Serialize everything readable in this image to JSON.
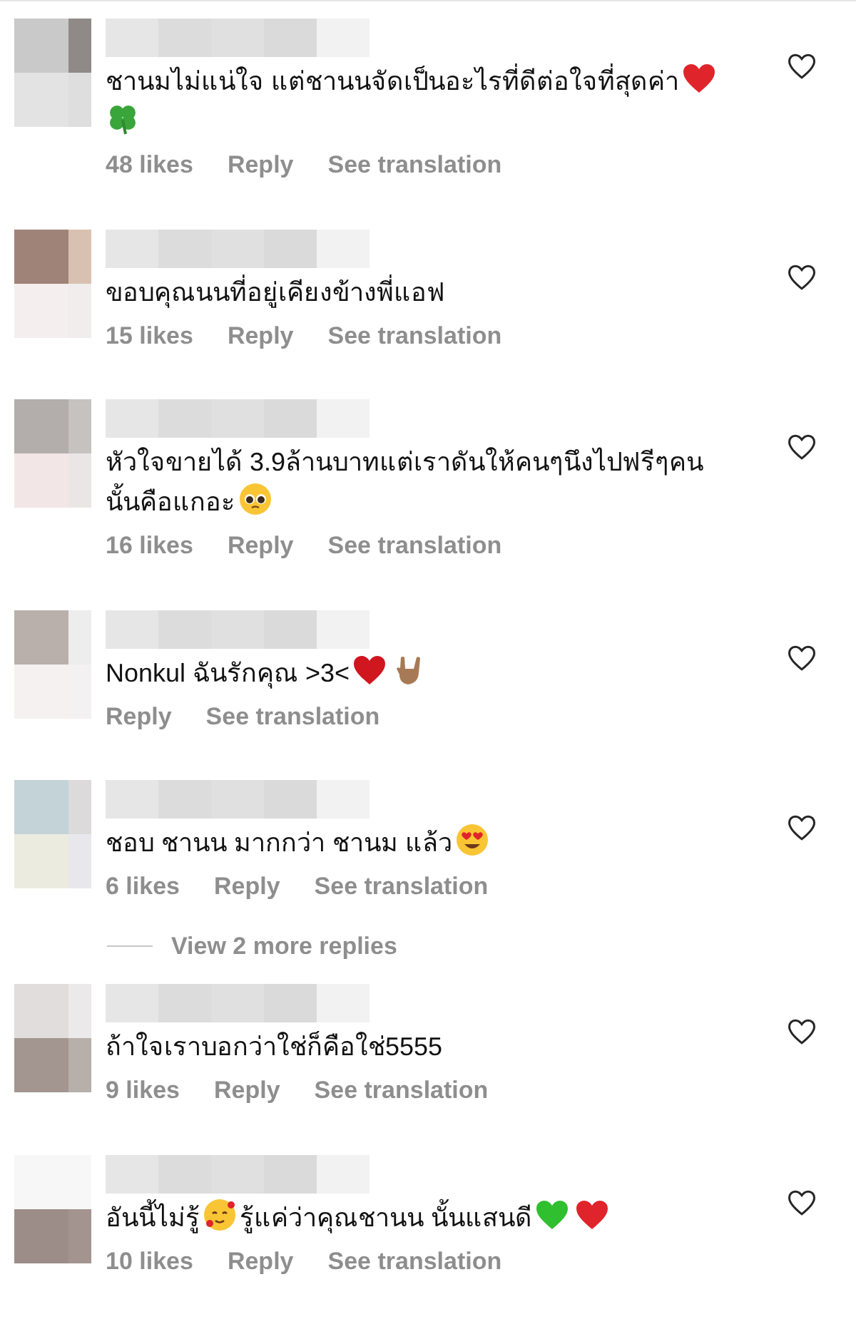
{
  "items": [
    {
      "kind": "comment",
      "liked": false,
      "body": [
        {
          "kind": "text",
          "text": "ชานมไม่แน่ใจ แต่ชานนจัดเป็นอะไรที่ดีต่อใจที่สุดค่า"
        },
        {
          "kind": "heart",
          "color": "#e0242b"
        },
        {
          "kind": "break"
        },
        {
          "kind": "clover"
        }
      ],
      "likes": "48 likes",
      "reply": "Reply",
      "translation": "See translation"
    },
    {
      "kind": "comment",
      "liked": false,
      "body": [
        {
          "kind": "text",
          "text": "ขอบคุณนนที่อยู่เคียงข้างพี่แอฟ"
        }
      ],
      "likes": "15 likes",
      "reply": "Reply",
      "translation": "See translation"
    },
    {
      "kind": "comment",
      "liked": false,
      "body": [
        {
          "kind": "text",
          "text": "หัวใจขายได้ 3.9ล้านบาทแต่เราดันให้คนๆนึงไปฟรีๆคน"
        },
        {
          "kind": "break"
        },
        {
          "kind": "text",
          "text": "นั้นคือแกอะ"
        },
        {
          "kind": "pleading"
        }
      ],
      "likes": "16 likes",
      "reply": "Reply",
      "translation": "See translation"
    },
    {
      "kind": "comment",
      "liked": false,
      "body": [
        {
          "kind": "text",
          "text": "Nonkul ฉันรักคุณ >3<"
        },
        {
          "kind": "heart",
          "color": "#d0161e"
        },
        {
          "kind": "hand"
        }
      ],
      "reply": "Reply",
      "translation": "See translation"
    },
    {
      "kind": "comment",
      "liked": false,
      "body": [
        {
          "kind": "text",
          "text": "ชอบ ชานน มากกว่า ชานม แล้ว"
        },
        {
          "kind": "heart-eyes"
        }
      ],
      "likes": "6 likes",
      "reply": "Reply",
      "translation": "See translation"
    },
    {
      "kind": "more",
      "text": "View 2 more replies"
    },
    {
      "kind": "comment",
      "liked": false,
      "body": [
        {
          "kind": "text",
          "text": "ถ้าใจเราบอกว่าใช่ก็คือใช่5555"
        }
      ],
      "likes": "9 likes",
      "reply": "Reply",
      "translation": "See translation"
    },
    {
      "kind": "comment",
      "liked": false,
      "body": [
        {
          "kind": "text",
          "text": "อันนี้ไม่รู้"
        },
        {
          "kind": "hearts-face"
        },
        {
          "kind": "text",
          "text": "รู้แค่ว่าคุณชานน นั้นแสนดี"
        },
        {
          "kind": "heart",
          "color": "#2fbf2f"
        },
        {
          "kind": "heart",
          "color": "#e0242b"
        }
      ],
      "likes": "10 likes",
      "reply": "Reply",
      "translation": "See translation"
    }
  ]
}
